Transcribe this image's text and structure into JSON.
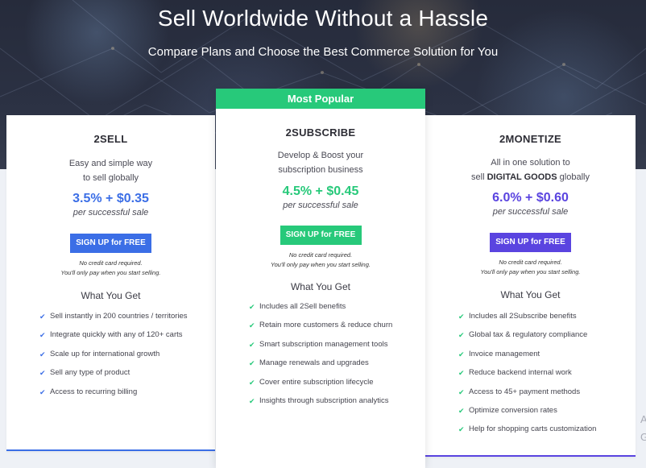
{
  "hero": {
    "title": "Sell Worldwide Without a Hassle",
    "subtitle": "Compare Plans and Choose the Best Commerce Solution for You"
  },
  "colors": {
    "blue": "#3b6ee6",
    "green": "#27c97a",
    "purple": "#5a44e0",
    "hero_dark": "#2b3143"
  },
  "plans": [
    {
      "name": "2SELL",
      "desc_line1": "Easy and simple way",
      "desc_line2": "to sell globally",
      "price": "3.5% + $0.35",
      "price_sub": "per successful sale",
      "cta": "SIGN UP for FREE",
      "note_line1": "No credit card required.",
      "note_line2": "You'll only pay when you start selling.",
      "what_you_get": "What You Get",
      "check_icon": "check-icon",
      "features": [
        "Sell instantly in 200 countries / territories",
        "Integrate quickly with any of 120+ carts",
        "Scale up for international growth",
        "Sell any type of product",
        "Access to recurring billing"
      ]
    },
    {
      "badge": "Most Popular",
      "name": "2SUBSCRIBE",
      "desc_line1": "Develop & Boost your",
      "desc_line2": "subscription business",
      "price": "4.5% + $0.45",
      "price_sub": "per successful sale",
      "cta": "SIGN UP for FREE",
      "note_line1": "No credit card required.",
      "note_line2": "You'll only pay when you start selling.",
      "what_you_get": "What You Get",
      "check_icon": "check-icon",
      "features": [
        "Includes all 2Sell benefits",
        "Retain more customers & reduce churn",
        "Smart subscription management tools",
        "Manage renewals and upgrades",
        "Cover entire subscription lifecycle",
        "Insights through subscription analytics"
      ]
    },
    {
      "name": "2MONETIZE",
      "desc_line1": "All in one solution to",
      "desc_line2_prefix": "sell ",
      "desc_line2_bold": "DIGITAL GOODS",
      "desc_line2_suffix": " globally",
      "price": "6.0% + $0.60",
      "price_sub": "per successful sale",
      "cta": "SIGN UP for FREE",
      "note_line1": "No credit card required.",
      "note_line2": "You'll only pay when you start selling.",
      "what_you_get": "What You Get",
      "check_icon": "check-icon",
      "features": [
        "Includes all 2Subscribe benefits",
        "Global tax & regulatory compliance",
        "Invoice management",
        "Reduce backend internal work",
        "Access to 45+ payment methods",
        "Optimize conversion rates",
        "Help for shopping carts customization"
      ]
    }
  ],
  "edge": {
    "letter1": "A",
    "letter2": "G"
  }
}
